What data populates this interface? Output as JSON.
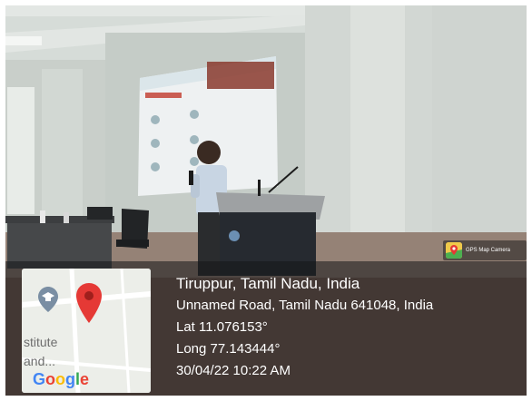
{
  "location": {
    "city_line": "Tiruppur, Tamil Nadu, India",
    "address_line": "Unnamed Road, Tamil Nadu 641048, India",
    "latitude_line": "Lat 11.076153°",
    "longitude_line": "Long 77.143444°",
    "datetime_line": "30/04/22 10:22 AM"
  },
  "map": {
    "label_line1": "stitute",
    "label_line2": "and...",
    "logo_letters": [
      {
        "char": "G",
        "color": "#4285F4"
      },
      {
        "char": "o",
        "color": "#EA4335"
      },
      {
        "char": "o",
        "color": "#FBBC05"
      },
      {
        "char": "g",
        "color": "#4285F4"
      },
      {
        "char": "l",
        "color": "#34A853"
      },
      {
        "char": "e",
        "color": "#EA4335"
      }
    ],
    "pin_color": "#e53935",
    "school_icon_color": "#7a8ea3"
  },
  "app_badge": {
    "name": "GPS Map Camera",
    "icon": "gps-map-camera-icon"
  }
}
